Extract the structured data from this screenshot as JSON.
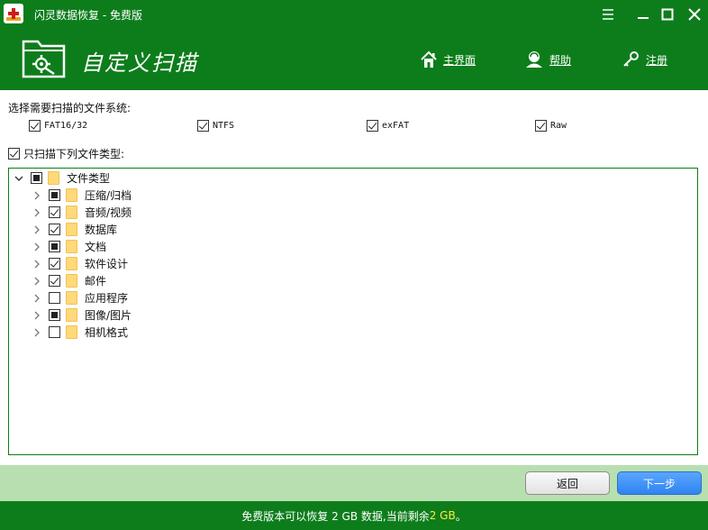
{
  "window": {
    "title": "闪灵数据恢复 - 免费版"
  },
  "header": {
    "title": "自定义扫描",
    "nav": {
      "home": "主界面",
      "help": "帮助",
      "register": "注册"
    }
  },
  "filesystem": {
    "label": "选择需要扫描的文件系统:",
    "options": [
      {
        "label": "FAT16/32",
        "checked": true
      },
      {
        "label": "NTFS",
        "checked": true
      },
      {
        "label": "exFAT",
        "checked": true
      },
      {
        "label": "Raw",
        "checked": true
      }
    ]
  },
  "filetypes": {
    "only_scan_label": "只扫描下列文件类型:",
    "only_scan_checked": true,
    "root": {
      "label": "文件类型",
      "state": "partial",
      "expanded": true
    },
    "items": [
      {
        "label": "压缩/归档",
        "state": "partial"
      },
      {
        "label": "音频/视频",
        "state": "checked"
      },
      {
        "label": "数据库",
        "state": "checked"
      },
      {
        "label": "文档",
        "state": "partial"
      },
      {
        "label": "软件设计",
        "state": "checked"
      },
      {
        "label": "邮件",
        "state": "checked"
      },
      {
        "label": "应用程序",
        "state": "unchecked"
      },
      {
        "label": "图像/图片",
        "state": "partial"
      },
      {
        "label": "相机格式",
        "state": "unchecked"
      }
    ]
  },
  "buttons": {
    "back": "返回",
    "next": "下一步"
  },
  "status": {
    "prefix": "免费版本可以恢复 2 GB 数据,当前剩余 ",
    "remaining": "2 GB",
    "suffix": "。"
  },
  "colors": {
    "brand_green": "#0d7d1c",
    "footer_light_green": "#b8dfb0",
    "next_button_blue": "#2f84f0",
    "status_highlight": "#ffeb3b",
    "folder_yellow": "#ffd97a"
  },
  "icons": {
    "app": "red-cross-icon",
    "banner": "folder-gear-icon",
    "home": "home-icon",
    "help": "user-help-icon",
    "register": "key-icon"
  }
}
